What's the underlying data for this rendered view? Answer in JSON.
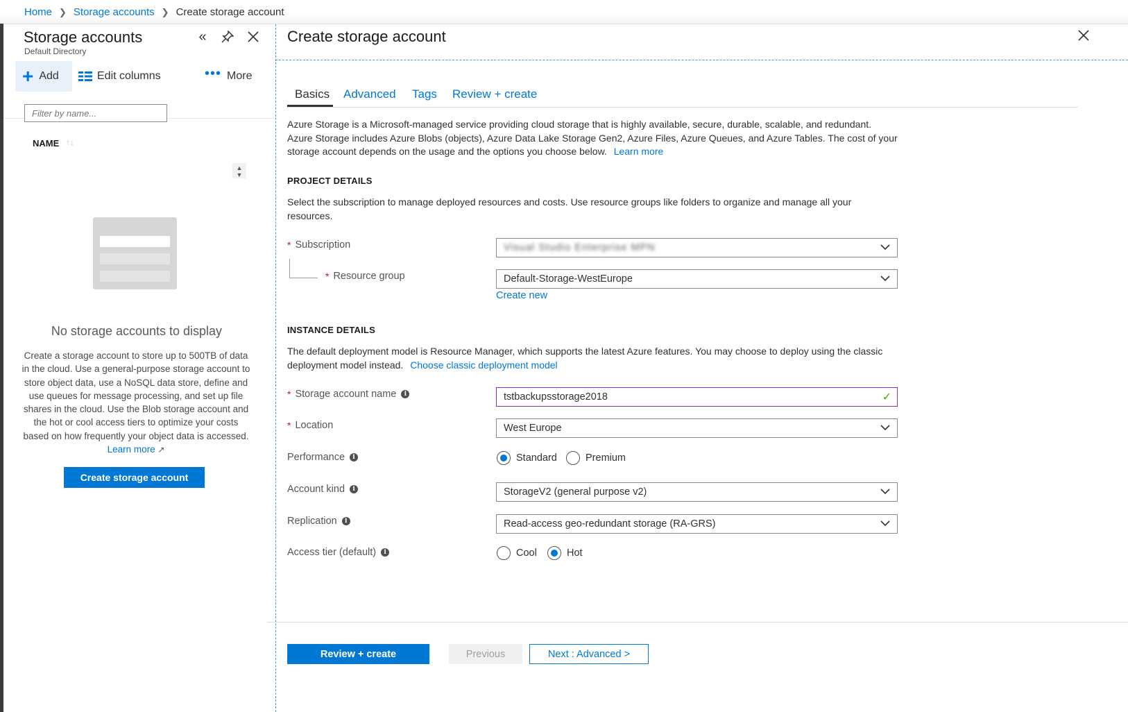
{
  "breadcrumb": {
    "home": "Home",
    "storage_accounts": "Storage accounts",
    "current": "Create storage account",
    "sep": ">"
  },
  "left_blade": {
    "title": "Storage accounts",
    "subtitle": "Default Directory",
    "toolbar": {
      "add": "Add",
      "edit_columns": "Edit columns",
      "more": "More"
    },
    "filter_placeholder": "Filter by name...",
    "column_name": "NAME",
    "empty_title": "No storage accounts to display",
    "empty_desc": "Create a storage account to store up to 500TB of data in the cloud. Use a general-purpose storage account to store object data, use a NoSQL data store, define and use queues for message processing, and set up file shares in the cloud. Use the Blob storage account and the hot or cool access tiers to optimize your costs based on how frequently your object data is accessed.",
    "learn_more": "Learn more",
    "create_button": "Create storage account"
  },
  "right_blade": {
    "title": "Create storage account",
    "tabs": [
      "Basics",
      "Advanced",
      "Tags",
      "Review + create"
    ],
    "intro": "Azure Storage is a Microsoft-managed service providing cloud storage that is highly available, secure, durable, scalable, and redundant. Azure Storage includes Azure Blobs (objects), Azure Data Lake Storage Gen2, Azure Files, Azure Queues, and Azure Tables. The cost of your storage account depends on the usage and the options you choose below.",
    "intro_link": "Learn more",
    "project_details": {
      "heading": "PROJECT DETAILS",
      "desc": "Select the subscription to manage deployed resources and costs. Use resource groups like folders to organize and manage all your resources.",
      "subscription_label": "Subscription",
      "subscription_value": "Visual Studio Enterprise MPN",
      "resource_group_label": "Resource group",
      "resource_group_value": "Default-Storage-WestEurope",
      "create_new": "Create new"
    },
    "instance_details": {
      "heading": "INSTANCE DETAILS",
      "desc": "The default deployment model is Resource Manager, which supports the latest Azure features. You may choose to deploy using the classic deployment model instead.",
      "desc_link": "Choose classic deployment model",
      "name_label": "Storage account name",
      "name_value": "tstbackupsstorage2018",
      "location_label": "Location",
      "location_value": "West Europe",
      "performance_label": "Performance",
      "performance_options": [
        "Standard",
        "Premium"
      ],
      "performance_selected": "Standard",
      "kind_label": "Account kind",
      "kind_value": "StorageV2 (general purpose v2)",
      "replication_label": "Replication",
      "replication_value": "Read-access geo-redundant storage (RA-GRS)",
      "tier_label": "Access tier (default)",
      "tier_options": [
        "Cool",
        "Hot"
      ],
      "tier_selected": "Hot"
    },
    "footer": {
      "review": "Review + create",
      "previous": "Previous",
      "next": "Next : Advanced >"
    }
  },
  "colors": {
    "accent": "#0078d4",
    "required": "#c8102e",
    "valid": "#57a300"
  }
}
